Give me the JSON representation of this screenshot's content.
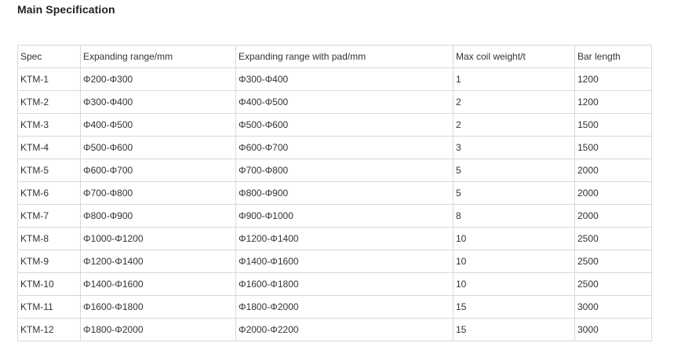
{
  "title": "Main Specification",
  "table": {
    "headers": [
      "Spec",
      "Expanding range/mm",
      "Expanding range with pad/mm",
      "Max coil weight/t",
      "Bar length"
    ],
    "rows": [
      [
        "KTM-1",
        "Φ200-Φ300",
        "Φ300-Φ400",
        "1",
        "1200"
      ],
      [
        "KTM-2",
        "Φ300-Φ400",
        "Φ400-Φ500",
        "2",
        "1200"
      ],
      [
        "KTM-3",
        "Φ400-Φ500",
        "Φ500-Φ600",
        "2",
        "1500"
      ],
      [
        "KTM-4",
        "Φ500-Φ600",
        "Φ600-Φ700",
        "3",
        "1500"
      ],
      [
        "KTM-5",
        "Φ600-Φ700",
        "Φ700-Φ800",
        "5",
        "2000"
      ],
      [
        "KTM-6",
        "Φ700-Φ800",
        "Φ800-Φ900",
        "5",
        "2000"
      ],
      [
        "KTM-7",
        "Φ800-Φ900",
        "Φ900-Φ1000",
        "8",
        "2000"
      ],
      [
        "KTM-8",
        "Φ1000-Φ1200",
        "Φ1200-Φ1400",
        "10",
        "2500"
      ],
      [
        "KTM-9",
        "Φ1200-Φ1400",
        "Φ1400-Φ1600",
        "10",
        "2500"
      ],
      [
        "KTM-10",
        "Φ1400-Φ1600",
        "Φ1600-Φ1800",
        "10",
        "2500"
      ],
      [
        "KTM-11",
        "Φ1600-Φ1800",
        "Φ1800-Φ2000",
        "15",
        "3000"
      ],
      [
        "KTM-12",
        "Φ1800-Φ2000",
        "Φ2000-Φ2200",
        "15",
        "3000"
      ]
    ]
  }
}
